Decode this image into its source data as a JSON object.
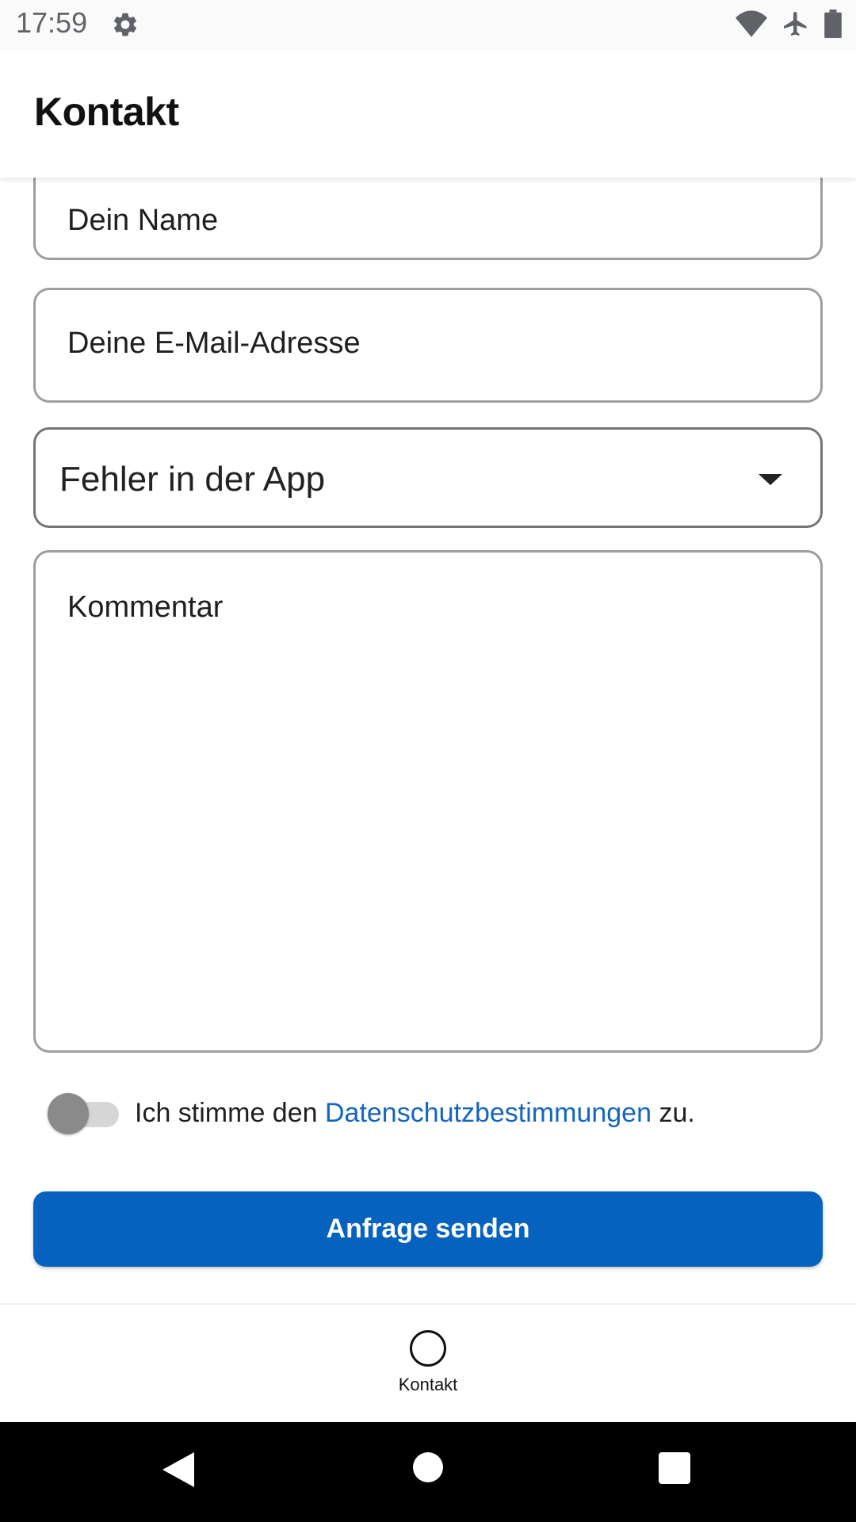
{
  "status_bar": {
    "time": "17:59",
    "icons": [
      "settings-icon",
      "wifi-icon",
      "airplane-mode-icon",
      "battery-icon"
    ]
  },
  "app_bar": {
    "title": "Kontakt"
  },
  "form": {
    "name_placeholder": "Dein Name",
    "email_placeholder": "Deine E-Mail-Adresse",
    "category_selected": "Fehler in der App",
    "comment_placeholder": "Kommentar",
    "consent": {
      "prefix": "Ich stimme den ",
      "link": "Datenschutzbestimmungen",
      "suffix": " zu.",
      "checked": false
    },
    "submit_label": "Anfrage senden"
  },
  "bottom_nav": {
    "items": [
      {
        "label": "Kontakt",
        "icon": "circle-icon"
      }
    ]
  },
  "colors": {
    "accent": "#0563bf",
    "link": "#1565c0",
    "border": "#9e9e9e"
  }
}
